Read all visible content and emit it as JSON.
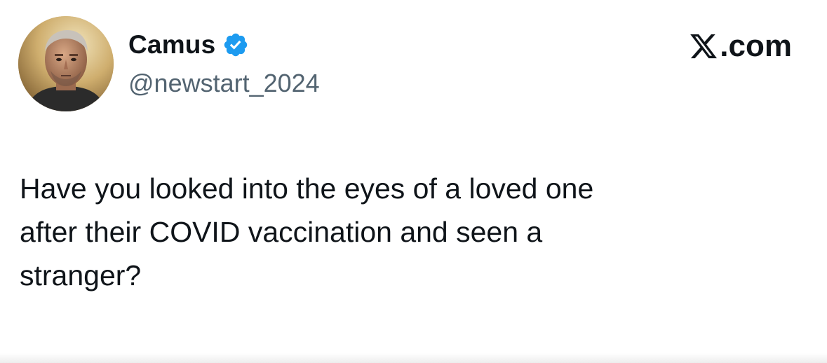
{
  "tweet": {
    "author": {
      "display_name": "Camus",
      "handle": "@newstart_2024",
      "verified": true,
      "avatar_icon": "profile-photo-man"
    },
    "site": {
      "logo_icon": "x-logo-icon",
      "domain": ".com"
    },
    "text": "Have you looked into the eyes of a loved one\nafter their COVID vaccination and seen a\nstranger?"
  },
  "colors": {
    "text_primary": "#0f1419",
    "text_secondary": "#536471",
    "verified_blue": "#1d9bf0",
    "background": "#ffffff"
  }
}
